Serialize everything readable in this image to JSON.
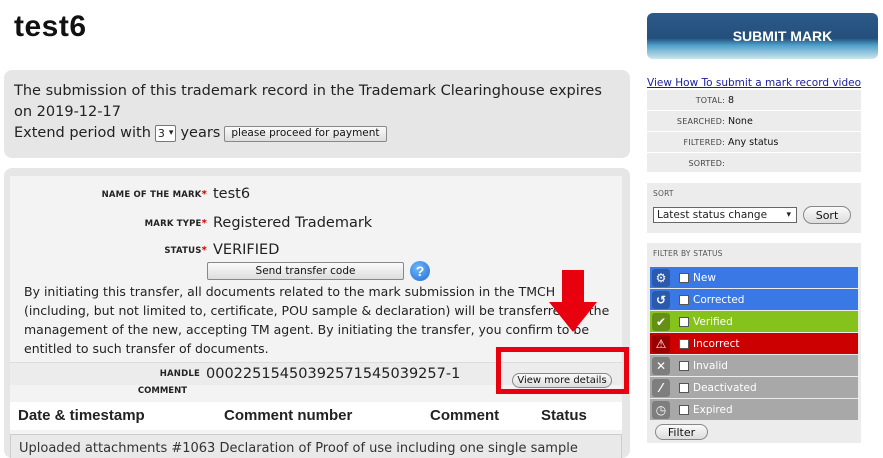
{
  "page": {
    "title": "test6"
  },
  "expiry": {
    "text": "The submission of this trademark record in the Trademark Clearinghouse expires on 2019-12-17",
    "extend_prefix": "Extend period with",
    "years_value": "3",
    "extend_suffix": "years",
    "proceed_label": "please proceed for payment"
  },
  "mark": {
    "name_label": "NAME OF THE MARK",
    "name_value": "test6",
    "type_label": "MARK TYPE",
    "type_value": "Registered Trademark",
    "status_label": "STATUS",
    "status_value": "VERIFIED",
    "required_marker": "*",
    "transfer_button": "Send transfer code",
    "help_glyph": "?",
    "transfer_text": "By initiating this transfer, all documents related to the mark submission in the TMCH (including, but not limited to, certificate, POU sample & declaration) will be transferred to the management of the new, accepting TM agent. By initiating the transfer, you confirm to be entitled to such transfer of documents.",
    "handle_label": "HANDLE",
    "handle_value": "000225154503925715450392​57-1",
    "view_more_label": "View more details",
    "comment_label": "COMMENT"
  },
  "comments_table": {
    "headers": [
      "Date & timestamp",
      "Comment number",
      "Comment",
      "Status"
    ],
    "first_row_text": "Uploaded attachments #1063 Declaration of Proof of use including one single sample"
  },
  "sidebar": {
    "submit_label": "SUBMIT MARK",
    "video_link": "View How To submit a mark record video",
    "stats": [
      {
        "label": "TOTAL:",
        "value": "8"
      },
      {
        "label": "SEARCHED:",
        "value": "None"
      },
      {
        "label": "FILTERED:",
        "value": "Any status"
      },
      {
        "label": "SORTED:",
        "value": ""
      }
    ],
    "sort_title": "SORT",
    "sort_value": "Latest status change",
    "sort_button": "Sort",
    "filter_title": "FILTER BY STATUS",
    "statuses": [
      {
        "label": "New",
        "color": "#3a78e6",
        "icon": "gear-icon",
        "glyph": "⚙"
      },
      {
        "label": "Corrected",
        "color": "#3a78e6",
        "icon": "undo-icon",
        "glyph": "↺"
      },
      {
        "label": "Verified",
        "color": "#86c21c",
        "icon": "check-icon",
        "glyph": "✔"
      },
      {
        "label": "Incorrect",
        "color": "#cc0000",
        "icon": "warning-icon",
        "glyph": "⚠"
      },
      {
        "label": "Invalid",
        "color": "#a8a8a8",
        "icon": "x-icon",
        "glyph": "✕"
      },
      {
        "label": "Deactivated",
        "color": "#a8a8a8",
        "icon": "slash-icon",
        "glyph": "⁄"
      },
      {
        "label": "Expired",
        "color": "#a8a8a8",
        "icon": "clock-icon",
        "glyph": "◷"
      }
    ],
    "filter_button": "Filter"
  },
  "annotation": {
    "color": "#e8000f"
  }
}
